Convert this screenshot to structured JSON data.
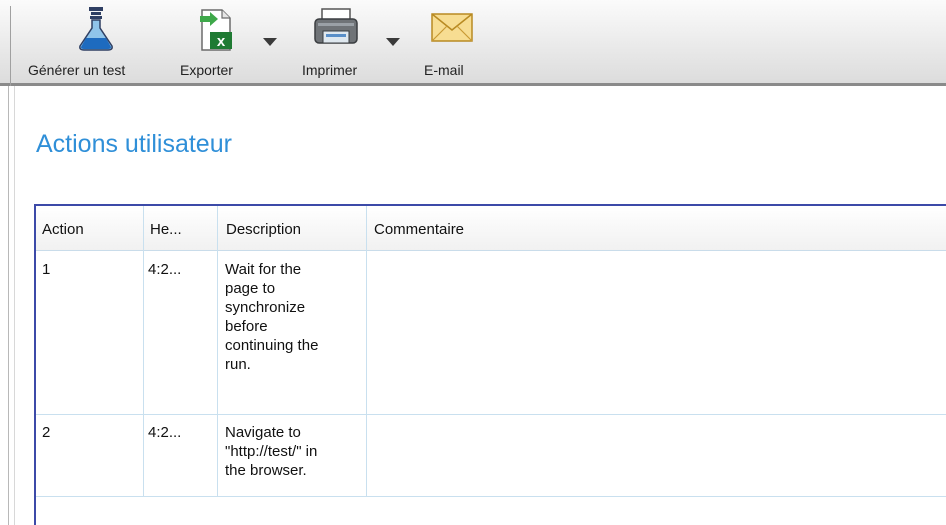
{
  "toolbar": {
    "buttons": [
      {
        "label": "Générer un test",
        "icon": "flask-test-icon"
      },
      {
        "label": "Exporter",
        "icon": "excel-export-icon",
        "has_dropdown": true
      },
      {
        "label": "Imprimer",
        "icon": "printer-icon",
        "has_dropdown": true
      },
      {
        "label": "E-mail",
        "icon": "envelope-icon"
      }
    ]
  },
  "main": {
    "title": "Actions utilisateur",
    "title_color": "#2f8fd8"
  },
  "table": {
    "columns": [
      "Action",
      "He...",
      "Description",
      "Commentaire"
    ],
    "rows": [
      {
        "action": "1",
        "heure": "4:2...",
        "description_lines": [
          "Wait for the",
          "page to",
          "synchronize",
          "before",
          "continuing the",
          "run."
        ],
        "commentaire": ""
      },
      {
        "action": "2",
        "heure": "4:2...",
        "description_lines": [
          "Navigate to",
          "\"http://test/\" in",
          "the browser."
        ],
        "commentaire": ""
      }
    ]
  },
  "colors": {
    "grid_border": "#3c4aa8",
    "cell_divider": "#c9e0ef"
  }
}
